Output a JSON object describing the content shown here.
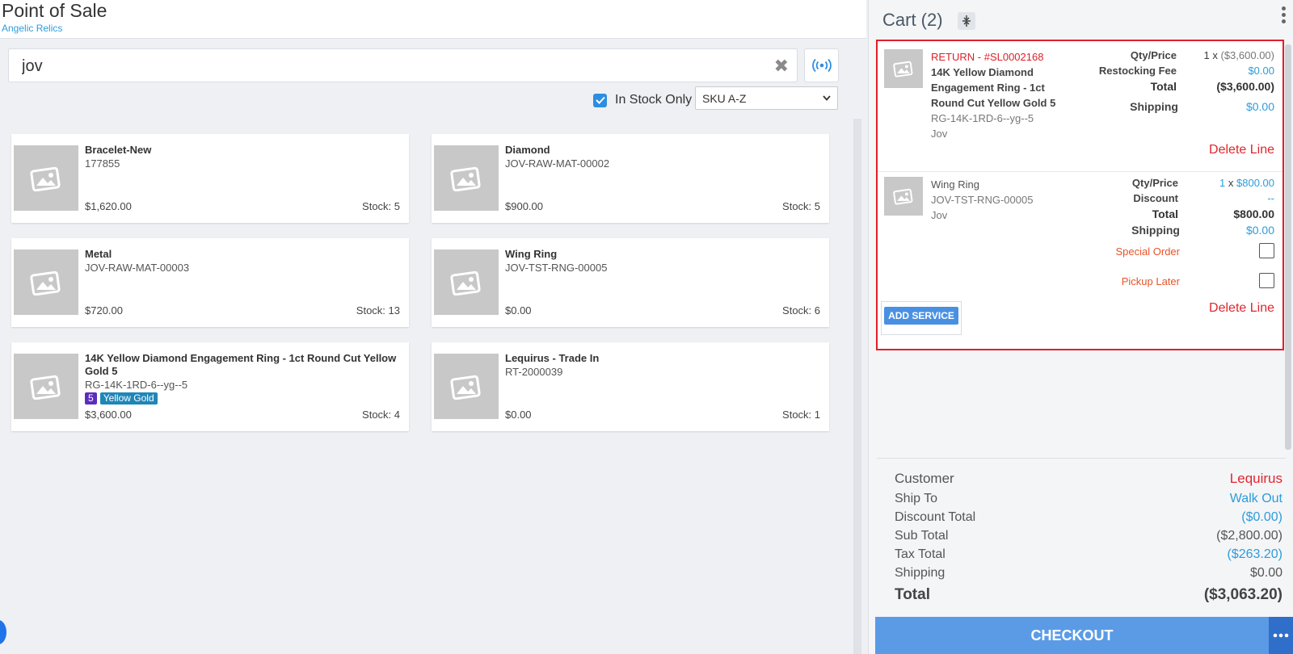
{
  "header": {
    "title": "Point of Sale",
    "store": "Angelic Relics"
  },
  "search": {
    "value": "jov",
    "clear_icon": "close-icon",
    "scan_icon": "broadcast-icon"
  },
  "filters": {
    "in_stock_label": "In Stock Only",
    "in_stock_checked": true,
    "sort_value": "SKU A-Z"
  },
  "products": [
    {
      "name": "Bracelet-New",
      "sku": "177855",
      "price": "$1,620.00",
      "stock": "Stock: 5"
    },
    {
      "name": "Diamond",
      "sku": "JOV-RAW-MAT-00002",
      "price": "$900.00",
      "stock": "Stock: 5"
    },
    {
      "name": "Metal",
      "sku": "JOV-RAW-MAT-00003",
      "price": "$720.00",
      "stock": "Stock: 13"
    },
    {
      "name": "Wing Ring",
      "sku": "JOV-TST-RNG-00005",
      "price": "$0.00",
      "stock": "Stock: 6"
    },
    {
      "name": "14K Yellow Diamond Engagement Ring - 1ct Round Cut Yellow Gold 5",
      "sku": "RG-14K-1RD-6--yg--5",
      "price": "$3,600.00",
      "stock": "Stock: 4",
      "tags": [
        "5",
        "Yellow Gold"
      ]
    },
    {
      "name": "Lequirus - Trade In",
      "sku": "RT-2000039",
      "price": "$0.00",
      "stock": "Stock: 1"
    }
  ],
  "cart": {
    "title": "Cart (2)",
    "lines": [
      {
        "return_label": "RETURN - #SL0002168",
        "name": "14K Yellow Diamond Engagement Ring - 1ct Round Cut Yellow Gold 5",
        "sku": "RG-14K-1RD-6--yg--5",
        "vendor": "Jov",
        "qty_price_label": "Qty/Price",
        "qty": "1",
        "x": "x",
        "unit_price": "($3,600.00)",
        "fee_label": "Restocking Fee",
        "fee_value": "$0.00",
        "total_label": "Total",
        "total_value": "($3,600.00)",
        "shipping_label": "Shipping",
        "shipping_value": "$0.00",
        "delete_label": "Delete Line"
      },
      {
        "name": "Wing Ring",
        "sku": "JOV-TST-RNG-00005",
        "vendor": "Jov",
        "qty_price_label": "Qty/Price",
        "qty": "1",
        "x": "x",
        "unit_price": "$800.00",
        "discount_label": "Discount",
        "discount_value": "--",
        "total_label": "Total",
        "total_value": "$800.00",
        "shipping_label": "Shipping",
        "shipping_value": "$0.00",
        "special_order_label": "Special Order",
        "pickup_later_label": "Pickup Later",
        "add_service_label": "ADD SERVICE",
        "delete_label": "Delete Line"
      }
    ],
    "summary": {
      "customer_label": "Customer",
      "customer_value": "Lequirus",
      "ship_to_label": "Ship To",
      "ship_to_value": "Walk Out",
      "discount_label": "Discount Total",
      "discount_value": "($0.00)",
      "subtotal_label": "Sub Total",
      "subtotal_value": "($2,800.00)",
      "tax_label": "Tax Total",
      "tax_value": "($263.20)",
      "shipping_label": "Shipping",
      "shipping_value": "$0.00",
      "total_label": "Total",
      "total_value": "($3,063.20)"
    },
    "checkout_label": "CHECKOUT"
  },
  "colors": {
    "accent": "#2d9cdb",
    "return_red": "#d8232a",
    "checkout": "#5b9be6",
    "tag_size": "#5b2dbd",
    "tag_metal": "#1f86b8"
  }
}
